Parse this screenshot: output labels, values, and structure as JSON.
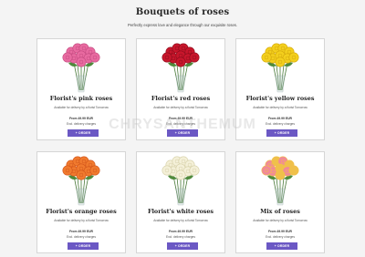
{
  "header": {
    "title": "Bouquets of roses",
    "subtitle": "Perfectly express love and elegance through our exquisite roses."
  },
  "watermark": "CHRYSANTHEMUM",
  "order_icon": "cart-icon",
  "cards": [
    {
      "name": "Florist's pink roses",
      "delivery": "Available for delivery by a florist Tomorrow",
      "price": "From 49.99 EUR",
      "charges": "Excl. delivery charges",
      "order": "+ ORDER",
      "color": "#e86aa0",
      "dark": "#c44a80"
    },
    {
      "name": "Florist's red roses",
      "delivery": "Available for delivery by a florist Tomorrow",
      "price": "From 49.99 EUR",
      "charges": "Excl. delivery charges",
      "order": "+ ORDER",
      "color": "#c8162c",
      "dark": "#8c0c1c"
    },
    {
      "name": "Florist's yellow roses",
      "delivery": "Available for delivery by a florist Tomorrow",
      "price": "From 49.99 EUR",
      "charges": "Excl. delivery charges",
      "order": "+ ORDER",
      "color": "#f3cf1d",
      "dark": "#d4a80c"
    },
    {
      "name": "Florist's orange roses",
      "delivery": "Available for delivery by a florist Tomorrow",
      "price": "From 49.99 EUR",
      "charges": "Excl. delivery charges",
      "order": "+ ORDER",
      "color": "#f07a2e",
      "dark": "#d2541a"
    },
    {
      "name": "Florist's white roses",
      "delivery": "Available for delivery by a florist Tomorrow",
      "price": "From 49.99 EUR",
      "charges": "Excl. delivery charges",
      "order": "+ ORDER",
      "color": "#f4f0d8",
      "dark": "#d6d0a8"
    },
    {
      "name": "Mix of roses",
      "delivery": "Available for delivery by a florist Tomorrow",
      "price": "From 49.99 EUR",
      "charges": "Excl. delivery charges",
      "order": "+ ORDER",
      "color": "#f1889a",
      "dark": "#f0c04a"
    }
  ]
}
